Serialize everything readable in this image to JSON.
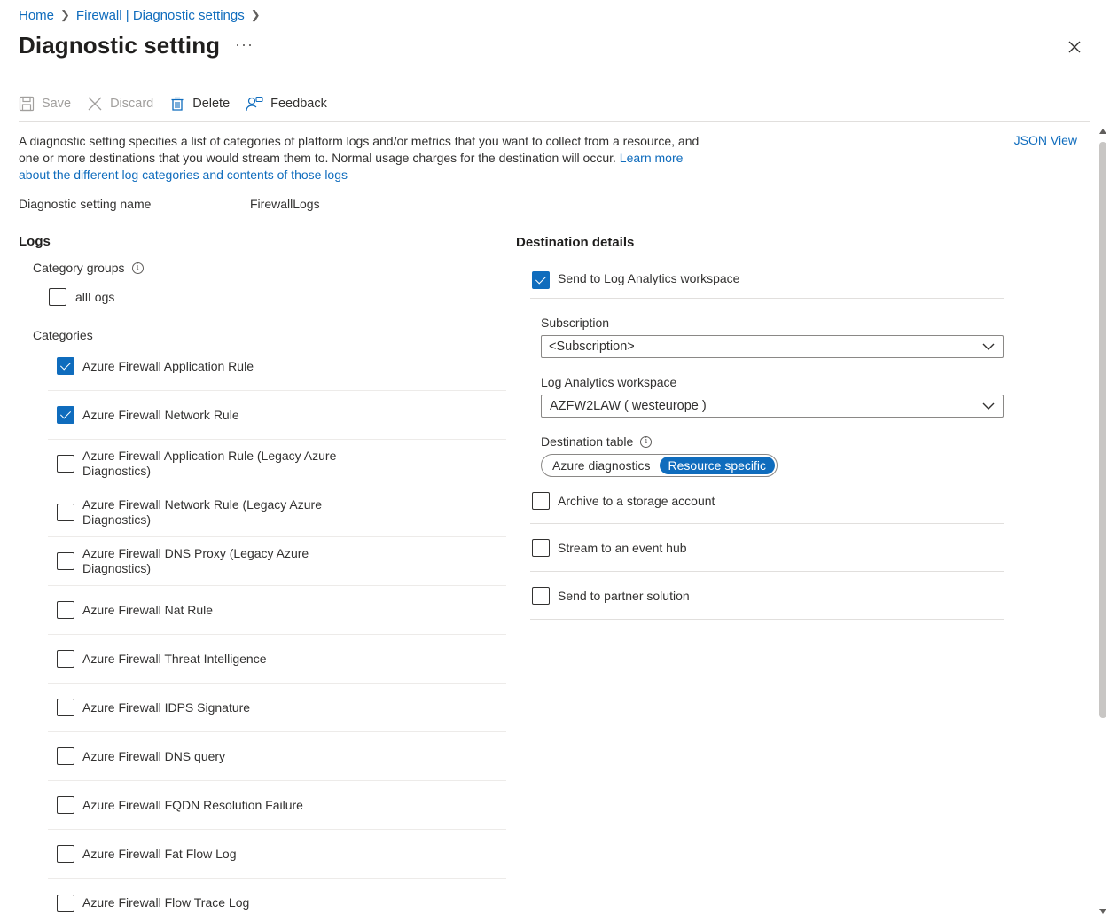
{
  "breadcrumb": [
    {
      "label": "Home"
    },
    {
      "label": "Firewall | Diagnostic settings"
    }
  ],
  "page_title": "Diagnostic setting",
  "more_label": "···",
  "toolbar": {
    "save": "Save",
    "discard": "Discard",
    "delete": "Delete",
    "feedback": "Feedback"
  },
  "description": {
    "text": "A diagnostic setting specifies a list of categories of platform logs and/or metrics that you want to collect from a resource, and one or more destinations that you would stream them to. Normal usage charges for the destination will occur.",
    "link": "Learn more about the different log categories and contents of those logs"
  },
  "json_view": "JSON View",
  "setting_name": {
    "label": "Diagnostic setting name",
    "value": "FirewallLogs"
  },
  "logs": {
    "title": "Logs",
    "category_groups_label": "Category groups",
    "all_logs": {
      "label": "allLogs",
      "checked": false
    },
    "categories_label": "Categories",
    "categories": [
      {
        "label": "Azure Firewall Application Rule",
        "checked": true
      },
      {
        "label": "Azure Firewall Network Rule",
        "checked": true
      },
      {
        "label": "Azure Firewall Application Rule (Legacy Azure Diagnostics)",
        "checked": false
      },
      {
        "label": "Azure Firewall Network Rule (Legacy Azure Diagnostics)",
        "checked": false
      },
      {
        "label": "Azure Firewall DNS Proxy (Legacy Azure Diagnostics)",
        "checked": false
      },
      {
        "label": "Azure Firewall Nat Rule",
        "checked": false
      },
      {
        "label": "Azure Firewall Threat Intelligence",
        "checked": false
      },
      {
        "label": "Azure Firewall IDPS Signature",
        "checked": false
      },
      {
        "label": "Azure Firewall DNS query",
        "checked": false
      },
      {
        "label": "Azure Firewall FQDN Resolution Failure",
        "checked": false
      },
      {
        "label": "Azure Firewall Fat Flow Log",
        "checked": false
      },
      {
        "label": "Azure Firewall Flow Trace Log",
        "checked": false
      }
    ]
  },
  "destination": {
    "title": "Destination details",
    "log_analytics": {
      "label": "Send to Log Analytics workspace",
      "checked": true
    },
    "subscription": {
      "label": "Subscription",
      "value": "<Subscription>"
    },
    "workspace": {
      "label": "Log Analytics workspace",
      "value": "AZFW2LAW ( westeurope )"
    },
    "destination_table": {
      "label": "Destination table",
      "options": [
        "Azure diagnostics",
        "Resource specific"
      ],
      "selected": "Resource specific"
    },
    "archive": {
      "label": "Archive to a storage account",
      "checked": false
    },
    "event_hub": {
      "label": "Stream to an event hub",
      "checked": false
    },
    "partner": {
      "label": "Send to partner solution",
      "checked": false
    }
  },
  "colors": {
    "accent": "#0f6cbd",
    "text": "#323130",
    "disabled": "#a19f9d"
  }
}
